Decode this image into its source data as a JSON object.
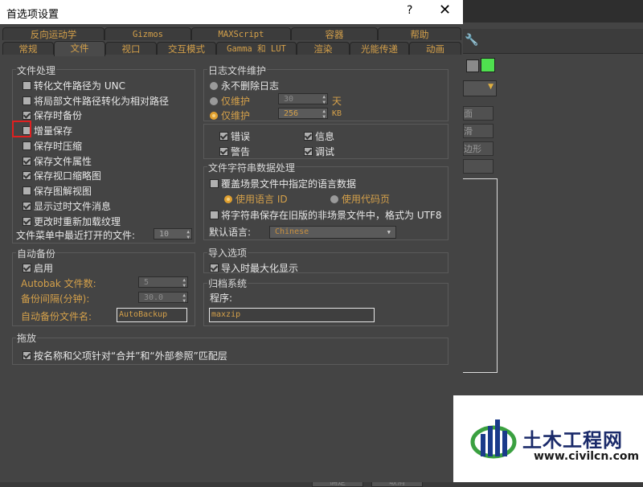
{
  "window": {
    "title": "首选项设置",
    "help_label": "?",
    "close_label": "✕"
  },
  "tabs_row1": [
    "反向运动学",
    "Gizmos",
    "MAXScript",
    "容器",
    "帮助"
  ],
  "tabs_row2": [
    "常规",
    "文件",
    "视口",
    "交互模式",
    "Gamma 和 LUT",
    "渲染",
    "光能传递",
    "动画"
  ],
  "active_tab": "文件",
  "file_handling": {
    "title": "文件处理",
    "items": [
      {
        "label": "转化文件路径为 UNC",
        "checked": false
      },
      {
        "label": "将局部文件路径转化为相对路径",
        "checked": false
      },
      {
        "label": "保存时备份",
        "checked": true
      },
      {
        "label": "增量保存",
        "checked": false
      },
      {
        "label": "保存时压缩",
        "checked": false
      },
      {
        "label": "保存文件属性",
        "checked": true
      },
      {
        "label": "保存视口缩略图",
        "checked": true
      },
      {
        "label": "保存图解视图",
        "checked": false
      },
      {
        "label": "显示过时文件消息",
        "checked": true
      },
      {
        "label": "更改时重新加载纹理",
        "checked": true
      }
    ],
    "recent_label": "文件菜单中最近打开的文件:",
    "recent_value": "10"
  },
  "log_maintenance": {
    "title": "日志文件维护",
    "never_delete": "永不删除日志",
    "keep_days_label": "仅维护",
    "keep_days_value": "30",
    "days_unit": "天",
    "keep_size_label": "仅维护",
    "keep_size_value": "256",
    "size_unit": "KB",
    "selected": "size"
  },
  "log_types": [
    {
      "label": "错误",
      "checked": true
    },
    {
      "label": "信息",
      "checked": true
    },
    {
      "label": "警告",
      "checked": true
    },
    {
      "label": "调试",
      "checked": true
    }
  ],
  "string_data": {
    "title": "文件字符串数据处理",
    "override_label": "覆盖场景文件中指定的语言数据",
    "use_lang": "使用语言 ID",
    "use_codepage": "使用代码页",
    "save_legacy": "将字符串保存在旧版的非场景文件中，格式为 UTF8",
    "default_lang_label": "默认语言:",
    "default_lang_value": "Chinese"
  },
  "auto_backup": {
    "title": "自动备份",
    "enable_label": "启用",
    "enable_checked": true,
    "files_label": "Autobak 文件数:",
    "files_value": "5",
    "interval_label": "备份间隔(分钟):",
    "interval_value": "30.0",
    "name_label": "自动备份文件名:",
    "name_value": "AutoBackup"
  },
  "import_options": {
    "title": "导入选项",
    "maximize_label": "导入时最大化显示",
    "checked": true
  },
  "archive": {
    "title": "归档系统",
    "program_label": "程序:",
    "program_value": "maxzip"
  },
  "drag": {
    "title": "拖放",
    "match_label": "按名称和父项针对“合并”和“外部参照”匹配层",
    "checked": true
  },
  "background": {
    "buttons": [
      "面",
      "滑",
      "边形"
    ],
    "bottom_buttons": [
      "确定",
      "取消"
    ]
  },
  "watermark": {
    "name": "土木工程网",
    "url": "www.civilcn.com",
    "colors": {
      "blue": "#1a3a8a",
      "green": "#3aa040"
    }
  }
}
